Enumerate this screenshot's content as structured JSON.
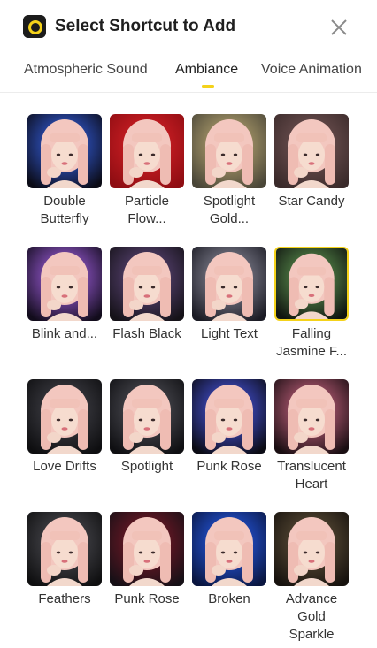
{
  "header": {
    "title": "Select Shortcut to Add",
    "app_icon": "app-logo-icon",
    "close_icon": "close-icon"
  },
  "tabs": [
    {
      "label": "Atmospheric Sound",
      "active": false
    },
    {
      "label": "Ambiance",
      "active": true
    },
    {
      "label": "Voice Animation",
      "active": false
    }
  ],
  "colors": {
    "accent": "#f4d21a",
    "text": "#222222"
  },
  "effects": [
    {
      "name": "Double Butterfly",
      "line1": "Double",
      "line2": "Butterfly",
      "bg": "#0b0b16",
      "glow": "#3b6cff",
      "selected": false
    },
    {
      "name": "Particle Flow...",
      "line1": "Particle",
      "line2": "Flow...",
      "bg": "#8e0d12",
      "glow": "#e0242a",
      "selected": false
    },
    {
      "name": "Spotlight Gold...",
      "line1": "Spotlight",
      "line2": "Gold...",
      "bg": "#4a4638",
      "glow": "#c9b57a",
      "selected": false
    },
    {
      "name": "Star Candy",
      "line1": "Star Candy",
      "line2": "",
      "bg": "#3a2a2a",
      "glow": "#7a5a5a",
      "selected": false
    },
    {
      "name": "Blink and...",
      "line1": "Blink and...",
      "line2": "",
      "bg": "#120c1c",
      "glow": "#b86cff",
      "selected": false
    },
    {
      "name": "Flash Black",
      "line1": "Flash Black",
      "line2": "",
      "bg": "#151218",
      "glow": "#6a4f8a",
      "selected": false
    },
    {
      "name": "Light Text",
      "line1": "Light Text",
      "line2": "",
      "bg": "#1b1b24",
      "glow": "#9a9aaa",
      "selected": false
    },
    {
      "name": "Falling Jasmine F...",
      "line1": "Falling",
      "line2": "Jasmine F...",
      "bg": "#101410",
      "glow": "#6aa85a",
      "selected": true
    },
    {
      "name": "Love Drifts",
      "line1": "Love Drifts",
      "line2": "",
      "bg": "#0e0e10",
      "glow": "#4a4a52",
      "selected": false
    },
    {
      "name": "Spotlight",
      "line1": "Spotlight",
      "line2": "",
      "bg": "#0f0f12",
      "glow": "#5a5a62",
      "selected": false
    },
    {
      "name": "Punk Rose",
      "line1": "Punk Rose",
      "line2": "",
      "bg": "#0b0b14",
      "glow": "#5060ff",
      "selected": false
    },
    {
      "name": "Translucent Heart",
      "line1": "Translucent",
      "line2": "Heart",
      "bg": "#1a0e12",
      "glow": "#e07090",
      "selected": false
    },
    {
      "name": "Feathers",
      "line1": "Feathers",
      "line2": "",
      "bg": "#0f0f10",
      "glow": "#55555c",
      "selected": false
    },
    {
      "name": "Punk Rose",
      "line1": "Punk Rose",
      "line2": "",
      "bg": "#161016",
      "glow": "#8a1a2a",
      "selected": false
    },
    {
      "name": "Broken",
      "line1": "Broken",
      "line2": "",
      "bg": "#0a1640",
      "glow": "#2a64ff",
      "selected": false
    },
    {
      "name": "Advance Gold Sparkle",
      "line1": "Advance",
      "line2": "Gold",
      "line3": "Sparkle",
      "bg": "#17120e",
      "glow": "#6a5a40",
      "selected": false
    }
  ]
}
